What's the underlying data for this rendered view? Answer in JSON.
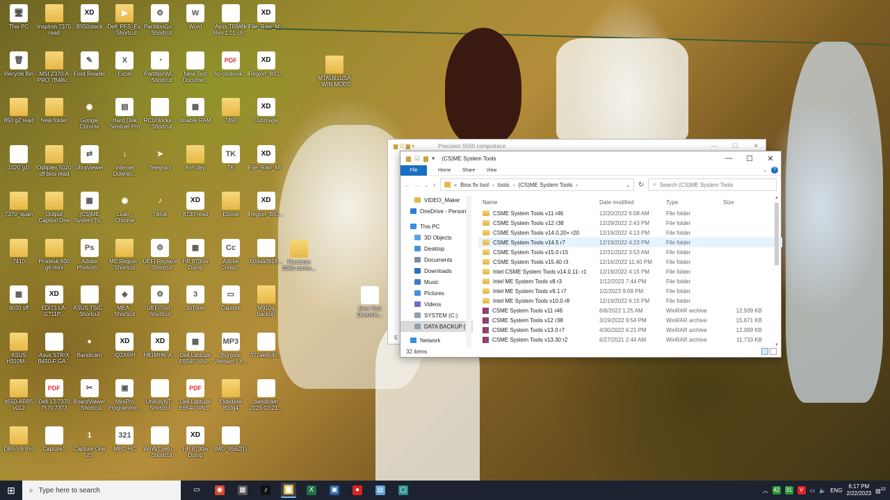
{
  "desktop": {
    "icons": [
      {
        "label": "This PC",
        "glyph": "🖥",
        "style": "doc"
      },
      {
        "label": "Inspiron 7370 read",
        "glyph": "",
        "style": "folder"
      },
      {
        "label": "B550steck",
        "glyph": "XD",
        "style": "xd"
      },
      {
        "label": "Dell_PFS_Ex... - Shortcut",
        "glyph": "▶",
        "style": "folder"
      },
      {
        "label": "PartitionGu... - Shortcut",
        "glyph": "⚙",
        "style": "doc"
      },
      {
        "label": "Word",
        "glyph": "W",
        "style": "doc"
      },
      {
        "label": "Asus TRM6k Rev 1.01 ch...",
        "glyph": "",
        "style": "doc"
      },
      {
        "label": "File_Raw_M...",
        "glyph": "XD",
        "style": "xd"
      },
      {
        "label": "Recycle Bin",
        "glyph": "🗑",
        "style": "doc"
      },
      {
        "label": "MSI Z370-A PRO 7B48v...",
        "glyph": "",
        "style": "folder"
      },
      {
        "label": "Foxit Reader",
        "glyph": "✎",
        "style": "doc"
      },
      {
        "label": "Excel",
        "glyph": "X",
        "style": "doc"
      },
      {
        "label": "PartitionWi... - Shortcut",
        "glyph": "◔",
        "style": "doc"
      },
      {
        "label": "New Text Docume...",
        "glyph": "",
        "style": "doc"
      },
      {
        "label": "hp-probook...",
        "glyph": "PDF",
        "style": "pdf"
      },
      {
        "label": "Region_BIO...",
        "glyph": "XD",
        "style": "xd"
      },
      {
        "label": "850 g2 read",
        "glyph": "",
        "style": "folder"
      },
      {
        "label": "New folder",
        "glyph": "",
        "style": "folder"
      },
      {
        "label": "Google Chrome",
        "glyph": "◉",
        "style": "round"
      },
      {
        "label": "Hard Disk Sentinel Pro",
        "glyph": "▤",
        "style": "doc"
      },
      {
        "label": "RCUnlocke... - Shortcut",
        "glyph": "",
        "style": "doc"
      },
      {
        "label": "disable RAM",
        "glyph": "▦",
        "style": "doc"
      },
      {
        "label": "7490",
        "glyph": "",
        "style": "folder"
      },
      {
        "label": "Outimage",
        "glyph": "XD",
        "style": "xd"
      },
      {
        "label": "1020 g1l",
        "glyph": "",
        "style": "doc"
      },
      {
        "label": "Optiplex 5020 sff bios read",
        "glyph": "",
        "style": "folder"
      },
      {
        "label": "UltraViewer",
        "glyph": "⇄",
        "style": "doc"
      },
      {
        "label": "Internet Downlo...",
        "glyph": "↓",
        "style": "round"
      },
      {
        "label": "Telegram",
        "glyph": "➤",
        "style": "round"
      },
      {
        "label": "Anh dep",
        "glyph": "",
        "style": "folder"
      },
      {
        "label": "TK",
        "glyph": "TK",
        "style": "doc"
      },
      {
        "label": "File_Raw_M...",
        "glyph": "XD",
        "style": "xd"
      },
      {
        "label": "7370_quan",
        "glyph": "",
        "style": "folder"
      },
      {
        "label": "Output Caption One",
        "glyph": "",
        "style": "folder"
      },
      {
        "label": "(CS)ME System To...",
        "glyph": "▦",
        "style": "doc"
      },
      {
        "label": "Luan - Chrome",
        "glyph": "◉",
        "style": "round"
      },
      {
        "label": "Tiktok",
        "glyph": "♪",
        "style": "round"
      },
      {
        "label": "8730 read",
        "glyph": "XD",
        "style": "xd"
      },
      {
        "label": "Ebook",
        "glyph": "",
        "style": "folder"
      },
      {
        "label": "Region_BIO...",
        "glyph": "XD",
        "style": "xd"
      },
      {
        "label": "7410",
        "glyph": "",
        "style": "folder"
      },
      {
        "label": "Prodesk 600 g6 mini",
        "glyph": "",
        "style": "folder"
      },
      {
        "label": "Adobe Photosh...",
        "glyph": "Ps",
        "style": "doc"
      },
      {
        "label": "ME Region - Shortcut",
        "glyph": "",
        "style": "folder"
      },
      {
        "label": "UEFI Replace - Shortcut",
        "glyph": "⚙",
        "style": "doc"
      },
      {
        "label": "HP 8730w Dump",
        "glyph": "▦",
        "style": "doc"
      },
      {
        "label": "Adobe Creati...",
        "glyph": "Cc",
        "style": "doc"
      },
      {
        "label": "60daa0918...",
        "glyph": "",
        "style": "doc"
      },
      {
        "label": "9020 sff",
        "glyph": "▦",
        "style": "doc"
      },
      {
        "label": "EDI73 LA-G711P...",
        "glyph": "XD",
        "style": "xd"
      },
      {
        "label": "ASUS TSIC - Shortcut",
        "glyph": "",
        "style": "doc"
      },
      {
        "label": "MEA - Shortcut",
        "glyph": "◈",
        "style": "doc"
      },
      {
        "label": "UEFITool - Shortcut",
        "glyph": "⚙",
        "style": "doc"
      },
      {
        "label": "3uTools",
        "glyph": "3",
        "style": "doc"
      },
      {
        "label": "Capture",
        "glyph": "▭",
        "style": "doc"
      },
      {
        "label": "M910q backup",
        "glyph": "",
        "style": "folder"
      },
      {
        "label": "ASUS H310M-...",
        "glyph": "",
        "style": "folder"
      },
      {
        "label": "Asus STRIX B450-F GA...",
        "glyph": "",
        "style": "doc"
      },
      {
        "label": "Bandicam",
        "glyph": "●",
        "style": "round"
      },
      {
        "label": "IQ2X6IH",
        "glyph": "XD",
        "style": "xd"
      },
      {
        "label": "H81MHK-A...",
        "glyph": "XD",
        "style": "xd"
      },
      {
        "label": "Dell Latitude E6540 VAL...",
        "glyph": "▦",
        "style": "doc"
      },
      {
        "label": "Bonjour Vietnam ( X...",
        "glyph": "MP3",
        "style": "doc"
      },
      {
        "label": "377ae9c4c...",
        "glyph": "",
        "style": "doc"
      },
      {
        "label": "b550-ARB5 v012",
        "glyph": "",
        "style": "folder"
      },
      {
        "label": "Dell 13-7370 7570 7373 7...",
        "glyph": "PDF",
        "style": "pdf"
      },
      {
        "label": "BoardViewer - Shortcut",
        "glyph": "✂",
        "style": "doc"
      },
      {
        "label": "MiniPro Programme...",
        "glyph": "▣",
        "style": "doc"
      },
      {
        "label": "UniKeyNT - Shortcut",
        "glyph": "",
        "style": "doc"
      },
      {
        "label": "Dell Latitude E6540 VAL...",
        "glyph": "PDF",
        "style": "pdf"
      },
      {
        "label": "Elitedesk 800g4",
        "glyph": "",
        "style": "folder"
      },
      {
        "label": "bandicam 2023-02-21...",
        "glyph": "",
        "style": "doc"
      },
      {
        "label": "DR5-V6 Pro",
        "glyph": "",
        "style": "folder"
      },
      {
        "label": "Capture1",
        "glyph": "",
        "style": "doc"
      },
      {
        "label": "Capture One 20",
        "glyph": "1",
        "style": "round"
      },
      {
        "label": "MPC-HC",
        "glyph": "321",
        "style": "doc"
      },
      {
        "label": "WinNTSetu... - Shortcut",
        "glyph": "",
        "style": "doc"
      },
      {
        "label": "HP 8730w Dump",
        "glyph": "XD",
        "style": "xd"
      },
      {
        "label": "IMG_9562[1]",
        "glyph": "",
        "style": "doc"
      },
      {
        "label": "MTAU91USA - WIN MODS",
        "glyph": "",
        "style": "folder"
      },
      {
        "label": "Precision 5560 comm...",
        "glyph": "",
        "style": "folder"
      },
      {
        "label": "New Text Docume...",
        "glyph": "",
        "style": "doc"
      }
    ]
  },
  "back_window": {
    "title": "Precision 5560 computrace"
  },
  "explorer": {
    "title": "(CS)ME System Tools",
    "ribbon": {
      "file": "File",
      "home": "Home",
      "share": "Share",
      "view": "View"
    },
    "breadcrumb": [
      "Bios fix tool",
      "tools",
      "(CS)ME System Tools"
    ],
    "search_placeholder": "Search (CS)ME System Tools",
    "nav": [
      {
        "label": "VIDEO_Maker",
        "icon": "folder",
        "indent": 2
      },
      {
        "label": "OneDrive - Person",
        "icon": "cloud",
        "indent": 1
      },
      {
        "label": "This PC",
        "icon": "pc",
        "indent": 1
      },
      {
        "label": "3D Objects",
        "icon": "3d",
        "indent": 2
      },
      {
        "label": "Desktop",
        "icon": "desk",
        "indent": 2
      },
      {
        "label": "Documents",
        "icon": "docs",
        "indent": 2
      },
      {
        "label": "Downloads",
        "icon": "down",
        "indent": 2
      },
      {
        "label": "Music",
        "icon": "music",
        "indent": 2
      },
      {
        "label": "Pictures",
        "icon": "pics",
        "indent": 2
      },
      {
        "label": "Videos",
        "icon": "vid",
        "indent": 2
      },
      {
        "label": "SYSTEM (C:)",
        "icon": "drive",
        "indent": 2
      },
      {
        "label": "DATA BACKUP (I:",
        "icon": "drive",
        "indent": 2
      },
      {
        "label": "Network",
        "icon": "net",
        "indent": 1
      }
    ],
    "columns": {
      "name": "Name",
      "date": "Date modified",
      "type": "Type",
      "size": "Size"
    },
    "files": [
      {
        "name": "CSME System Tools v11 r46",
        "date": "12/20/2022 6:08 AM",
        "type": "File folder",
        "size": "",
        "kind": "folder"
      },
      {
        "name": "CSME System Tools v12 r38",
        "date": "12/29/2022 2:43 PM",
        "type": "File folder",
        "size": "",
        "kind": "folder"
      },
      {
        "name": "CSME System Tools v14.0.20+ r20",
        "date": "12/19/2022 4:13 PM",
        "type": "File folder",
        "size": "",
        "kind": "folder"
      },
      {
        "name": "CSME System Tools v14.5 r7",
        "date": "12/19/2022 4:23 PM",
        "type": "File folder",
        "size": "",
        "kind": "folder"
      },
      {
        "name": "CSME System Tools v15.0 r15",
        "date": "12/31/2022 3:53 AM",
        "type": "File folder",
        "size": "",
        "kind": "folder"
      },
      {
        "name": "CSME System Tools v15.40 r3",
        "date": "12/16/2022 11:40 PM",
        "type": "File folder",
        "size": "",
        "kind": "folder"
      },
      {
        "name": "Intel CSME System Tools v14.0.11- r1",
        "date": "12/19/2022 4:15 PM",
        "type": "File folder",
        "size": "",
        "kind": "folder"
      },
      {
        "name": "Intel ME System Tools v8 r3",
        "date": "1/12/2023 7:44 PM",
        "type": "File folder",
        "size": "",
        "kind": "folder"
      },
      {
        "name": "Intel ME System Tools v9.1 r7",
        "date": "1/2/2023 9:09 PM",
        "type": "File folder",
        "size": "",
        "kind": "folder"
      },
      {
        "name": "Intel ME System Tools v10.0 r8",
        "date": "12/19/2022 6:15 PM",
        "type": "File folder",
        "size": "",
        "kind": "folder"
      },
      {
        "name": "CSME System Tools v11 r46",
        "date": "6/6/2022 1:25 AM",
        "type": "WinRAR archive",
        "size": "12,939 KB",
        "kind": "rar"
      },
      {
        "name": "CSME System Tools v12 r38",
        "date": "3/19/2022 9:54 PM",
        "type": "WinRAR archive",
        "size": "15,671 KB",
        "kind": "rar"
      },
      {
        "name": "CSME System Tools v13.0 r7",
        "date": "4/30/2022 6:21 PM",
        "type": "WinRAR archive",
        "size": "12,099 KB",
        "kind": "rar"
      },
      {
        "name": "CSME System Tools v13.30 r2",
        "date": "6/27/2021 2:44 AM",
        "type": "WinRAR archive",
        "size": "11,733 KB",
        "kind": "rar"
      }
    ],
    "status": "32 items",
    "back_status": "5"
  },
  "taskbar": {
    "search_placeholder": "Type here to search",
    "apps": [
      "task-view",
      "chrome",
      "multi",
      "tiktok",
      "explorer",
      "excel",
      "cpu",
      "record",
      "notepad",
      "app"
    ],
    "tray": {
      "lang": "ENG",
      "time": "6:17 PM",
      "date": "2/22/2023",
      "notif": "22",
      "badge1": "42",
      "badge2": "31"
    }
  }
}
